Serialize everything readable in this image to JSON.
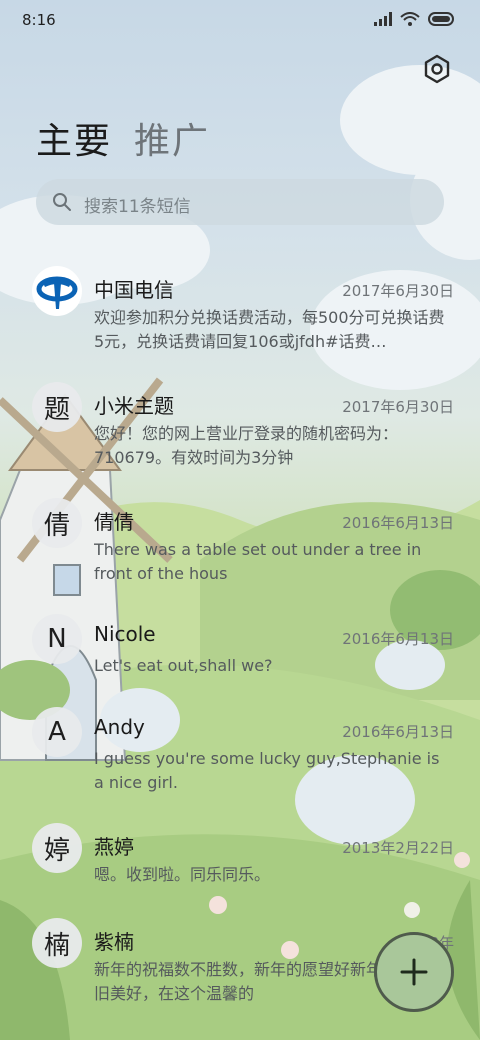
{
  "status_bar": {
    "time": "8:16"
  },
  "tabs": {
    "main": "主要",
    "promotions": "推广"
  },
  "search": {
    "placeholder": "搜索11条短信"
  },
  "messages": [
    {
      "sender": "中国电信",
      "avatar": "",
      "date": "2017年6月30日",
      "preview": "欢迎参加积分兑换话费活动，每500分可兑换话费5元，兑换话费请回复106或jfdh#话费…"
    },
    {
      "sender": "小米主题",
      "avatar": "题",
      "date": "2017年6月30日",
      "preview": "您好！您的网上营业厅登录的随机密码为：710679。有效时间为3分钟"
    },
    {
      "sender": "倩倩",
      "avatar": "倩",
      "date": "2016年6月13日",
      "preview": "There was a table set out under a tree in front of the hous"
    },
    {
      "sender": "Nicole",
      "avatar": "N",
      "date": "2016年6月13日",
      "preview": "Let's eat out,shall we?"
    },
    {
      "sender": "Andy",
      "avatar": "A",
      "date": "2016年6月13日",
      "preview": "I guess you're some lucky guy,Stephanie is a nice girl."
    },
    {
      "sender": "燕婷",
      "avatar": "婷",
      "date": "2013年2月22日",
      "preview": "嗯。收到啦。同乐同乐。"
    },
    {
      "sender": "紫楠",
      "avatar": "楠",
      "date": "2013年",
      "preview": "新年的祝福数不胜数，新年的愿望好新年的问候依旧美好，在这个温馨的"
    }
  ],
  "icons": {
    "settings": "gear-icon",
    "search": "search-icon",
    "compose": "plus-icon",
    "carrier_logo": "china-telecom-logo"
  },
  "colors": {
    "fab": "#a9c79a",
    "search_bg": "#ced9e0"
  }
}
